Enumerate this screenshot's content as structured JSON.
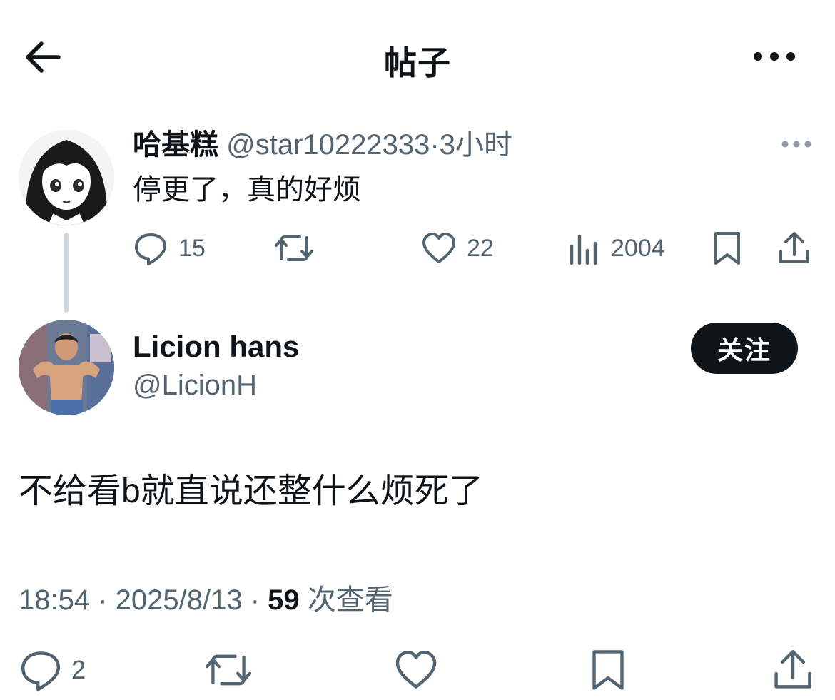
{
  "header": {
    "title": "帖子",
    "back_icon": "arrow-left-icon",
    "more_icon": "more-horizontal-icon"
  },
  "parent_tweet": {
    "author_name": "哈基糕",
    "handle": "@star10222333",
    "separator": "·",
    "time": "3小时",
    "text": "停更了，真的好烦",
    "actions": {
      "reply_count": "15",
      "retweet_count": "",
      "like_count": "22",
      "views_count": "2004"
    }
  },
  "main_tweet": {
    "author_name": "Licion hans",
    "handle": "@LicionH",
    "follow_label": "关注",
    "text": "不给看b就直说还整什么烦死了",
    "meta": {
      "time": "18:54",
      "sep1": " · ",
      "date": "2025/8/13",
      "sep2": " · ",
      "views_count": "59",
      "views_label": " 次查看"
    },
    "actions": {
      "reply_count": "2"
    }
  },
  "colors": {
    "text_primary": "#0f1419",
    "text_secondary": "#536471",
    "thread_line": "#cfd9de",
    "follow_bg": "#0f1419"
  }
}
